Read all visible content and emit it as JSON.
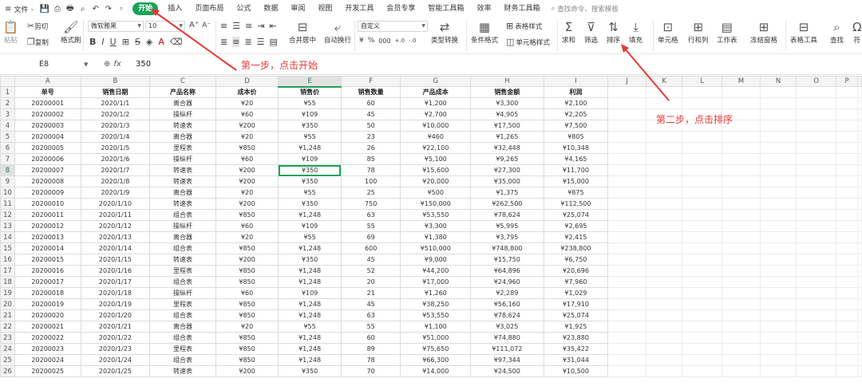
{
  "menubar": {
    "file": "文件",
    "tabs": [
      "开始",
      "插入",
      "页面布局",
      "公式",
      "数据",
      "审阅",
      "视图",
      "开发工具",
      "会员专享",
      "智能工具箱",
      "效率",
      "财务工具箱"
    ],
    "search": "查找命令、搜索模板"
  },
  "ribbon": {
    "paste": "粘贴",
    "cut": "剪切",
    "copy": "复制",
    "format_painter": "格式刷",
    "font_name": "微软雅黑",
    "font_size": "10",
    "merge_center": "合并居中",
    "wrap_text": "自动换行",
    "number_format": "自定义",
    "type_convert": "类型转换",
    "cond_format": "条件格式",
    "table_style": "表格样式",
    "cell_style": "单元格样式",
    "sum": "求和",
    "filter": "筛选",
    "sort": "排序",
    "fill": "填充",
    "cell": "单元格",
    "row_col": "行和列",
    "worksheet": "工作表",
    "freeze": "冻结窗格",
    "table_tools": "表格工具",
    "find": "查找",
    "symbol": "符"
  },
  "formula_bar": {
    "name_box": "E8",
    "fx": "fx",
    "value": "350"
  },
  "sheet": {
    "columns": [
      "A",
      "B",
      "C",
      "D",
      "E",
      "F",
      "G",
      "H",
      "I",
      "J",
      "K",
      "L",
      "M",
      "N",
      "O",
      "P"
    ],
    "header_row": [
      "单号",
      "销售日期",
      "产品名称",
      "成本价",
      "销售价",
      "销售数量",
      "产品成本",
      "销售金额",
      "利润"
    ],
    "rows": [
      [
        "20200001",
        "2020/1/1",
        "离合器",
        "¥20",
        "¥55",
        "60",
        "¥1,200",
        "¥3,300",
        "¥2,100"
      ],
      [
        "20200002",
        "2020/1/2",
        "操纵杆",
        "¥60",
        "¥109",
        "45",
        "¥2,700",
        "¥4,905",
        "¥2,205"
      ],
      [
        "20200003",
        "2020/1/3",
        "转速表",
        "¥200",
        "¥350",
        "50",
        "¥10,000",
        "¥17,500",
        "¥7,500"
      ],
      [
        "20200004",
        "2020/1/4",
        "离合器",
        "¥20",
        "¥55",
        "23",
        "¥460",
        "¥1,265",
        "¥805"
      ],
      [
        "20200005",
        "2020/1/5",
        "里程表",
        "¥850",
        "¥1,248",
        "26",
        "¥22,100",
        "¥32,448",
        "¥10,348"
      ],
      [
        "20200006",
        "2020/1/6",
        "操纵杆",
        "¥60",
        "¥109",
        "85",
        "¥5,100",
        "¥9,265",
        "¥4,165"
      ],
      [
        "20200007",
        "2020/1/7",
        "转速表",
        "¥200",
        "¥350",
        "78",
        "¥15,600",
        "¥27,300",
        "¥11,700"
      ],
      [
        "20200008",
        "2020/1/8",
        "转速表",
        "¥200",
        "¥350",
        "100",
        "¥20,000",
        "¥35,000",
        "¥15,000"
      ],
      [
        "20200009",
        "2020/1/9",
        "离合器",
        "¥20",
        "¥55",
        "25",
        "¥500",
        "¥1,375",
        "¥875"
      ],
      [
        "20200010",
        "2020/1/10",
        "转速表",
        "¥200",
        "¥350",
        "750",
        "¥150,000",
        "¥262,500",
        "¥112,500"
      ],
      [
        "20200011",
        "2020/1/11",
        "组合表",
        "¥850",
        "¥1,248",
        "63",
        "¥53,550",
        "¥78,624",
        "¥25,074"
      ],
      [
        "20200012",
        "2020/1/12",
        "操纵杆",
        "¥60",
        "¥109",
        "55",
        "¥3,300",
        "¥5,995",
        "¥2,695"
      ],
      [
        "20200013",
        "2020/1/13",
        "离合器",
        "¥20",
        "¥55",
        "69",
        "¥1,380",
        "¥3,795",
        "¥2,415"
      ],
      [
        "20200014",
        "2020/1/14",
        "组合表",
        "¥850",
        "¥1,248",
        "600",
        "¥510,000",
        "¥748,800",
        "¥238,800"
      ],
      [
        "20200015",
        "2020/1/15",
        "转速表",
        "¥200",
        "¥350",
        "45",
        "¥9,000",
        "¥15,750",
        "¥6,750"
      ],
      [
        "20200016",
        "2020/1/16",
        "里程表",
        "¥850",
        "¥1,248",
        "52",
        "¥44,200",
        "¥64,896",
        "¥20,696"
      ],
      [
        "20200017",
        "2020/1/17",
        "组合表",
        "¥850",
        "¥1,248",
        "20",
        "¥17,000",
        "¥24,960",
        "¥7,960"
      ],
      [
        "20200018",
        "2020/1/18",
        "操纵杆",
        "¥60",
        "¥109",
        "21",
        "¥1,260",
        "¥2,289",
        "¥1,029"
      ],
      [
        "20200019",
        "2020/1/19",
        "里程表",
        "¥850",
        "¥1,248",
        "45",
        "¥38,250",
        "¥56,160",
        "¥17,910"
      ],
      [
        "20200020",
        "2020/1/20",
        "组合表",
        "¥850",
        "¥1,248",
        "63",
        "¥53,550",
        "¥78,624",
        "¥25,074"
      ],
      [
        "20200021",
        "2020/1/21",
        "离合器",
        "¥20",
        "¥55",
        "55",
        "¥1,100",
        "¥3,025",
        "¥1,925"
      ],
      [
        "20200022",
        "2020/1/22",
        "组合表",
        "¥850",
        "¥1,248",
        "60",
        "¥51,000",
        "¥74,880",
        "¥23,880"
      ],
      [
        "20200023",
        "2020/1/23",
        "里程表",
        "¥850",
        "¥1,248",
        "89",
        "¥75,650",
        "¥111,072",
        "¥35,422"
      ],
      [
        "20200024",
        "2020/1/24",
        "组合表",
        "¥850",
        "¥1,248",
        "78",
        "¥66,300",
        "¥97,344",
        "¥31,044"
      ],
      [
        "20200025",
        "2020/1/25",
        "转速表",
        "¥200",
        "¥350",
        "70",
        "¥14,000",
        "¥24,500",
        "¥10,500"
      ]
    ],
    "active_cell": "E8"
  },
  "annotations": {
    "step1": "第一步，点击开始",
    "step2": "第二步，点击排序"
  },
  "colors": {
    "accent": "#1aa35a",
    "annotation": "#e53935"
  }
}
